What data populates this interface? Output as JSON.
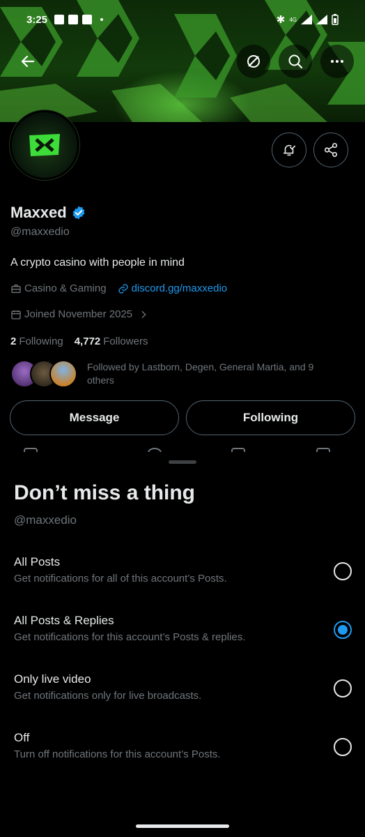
{
  "status_bar": {
    "time": "3:25",
    "network": "4G"
  },
  "profile": {
    "name": "Maxxed",
    "handle": "@maxxedio",
    "bio": "A crypto casino with people in mind",
    "category": "Casino & Gaming",
    "link": "discord.gg/maxxedio",
    "joined": "Joined November 2025",
    "following_count": "2",
    "following_label": "Following",
    "followers_count": "4,772",
    "followers_label": "Followers",
    "followed_by": "Followed by Lastborn, Degen, General Martia, and 9 others",
    "message_label": "Message",
    "following_button_label": "Following"
  },
  "sheet": {
    "title": "Don’t miss a thing",
    "subtitle": "@maxxedio",
    "options": [
      {
        "title": "All Posts",
        "desc": "Get notifications for all of this account’s Posts.",
        "selected": false
      },
      {
        "title": "All Posts & Replies",
        "desc": "Get notifications for this account’s Posts & replies.",
        "selected": true
      },
      {
        "title": "Only live video",
        "desc": "Get notifications only for live broadcasts.",
        "selected": false
      },
      {
        "title": "Off",
        "desc": "Turn off notifications for this account’s Posts.",
        "selected": false
      }
    ]
  },
  "colors": {
    "accent": "#1d9bf0",
    "brand_green": "#3ddc3a",
    "muted": "#71767b",
    "text": "#e7e9ea"
  },
  "icons": [
    "back-arrow-icon",
    "grok-icon",
    "search-icon",
    "more-icon",
    "bell-check-icon",
    "share-icon",
    "verified-badge-icon",
    "briefcase-icon",
    "link-icon",
    "calendar-icon",
    "chevron-right-icon"
  ]
}
